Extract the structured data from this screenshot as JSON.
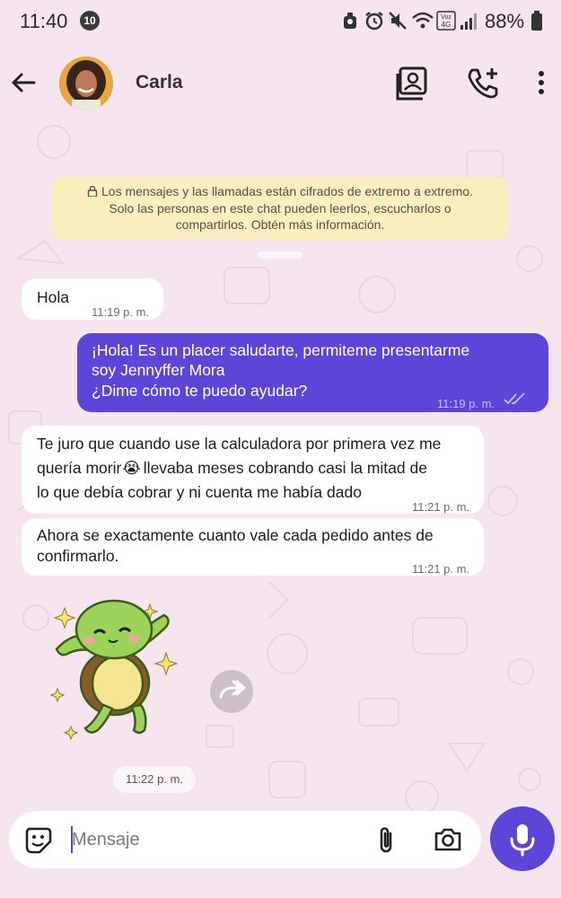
{
  "status_bar": {
    "time": "11:40",
    "notification_count": "10",
    "battery": "88%",
    "network_label": "Voz 4G"
  },
  "header": {
    "contact_name": "Carla"
  },
  "encryption_notice": {
    "lines": [
      "Los mensajes y las llamadas están cifrados de extremo a extremo.",
      "Solo las personas en este chat pueden leerlos, escucharlos o",
      "compartirlos. Obtén más información."
    ]
  },
  "messages": [
    {
      "direction": "incoming",
      "lines": [
        "Hola"
      ],
      "time": "11:19 p. m."
    },
    {
      "direction": "outgoing",
      "lines": [
        "¡Hola! Es un placer saludarte, permiteme presentarme",
        "soy  Jennyffer Mora",
        "¿Dime cómo te puedo ayudar?"
      ],
      "time": "11:19 p. m.",
      "status": "read"
    },
    {
      "direction": "incoming",
      "lines": [
        "Te juro que cuando use la calculadora por primera vez me",
        "quería morir",
        "llevaba meses cobrando casi la mitad de",
        "lo que debía cobrar y ni cuenta me había dado"
      ],
      "emoji": "😭",
      "time": "11:21 p. m."
    },
    {
      "direction": "incoming",
      "lines": [
        "Ahora se exactamente cuanto vale cada pedido antes de",
        "confirmarlo."
      ],
      "time": "11:21 p. m."
    }
  ],
  "sticker": {
    "description_icon": "turtle-sticker",
    "time": "11:22 p. m."
  },
  "composer": {
    "placeholder": "Mensaje"
  },
  "colors": {
    "background": "#f6e4ef",
    "outgoing_bubble": "#5d45d8",
    "incoming_bubble": "#ffffff",
    "notice_bg": "#fbeebf",
    "accent": "#5d45d8"
  }
}
